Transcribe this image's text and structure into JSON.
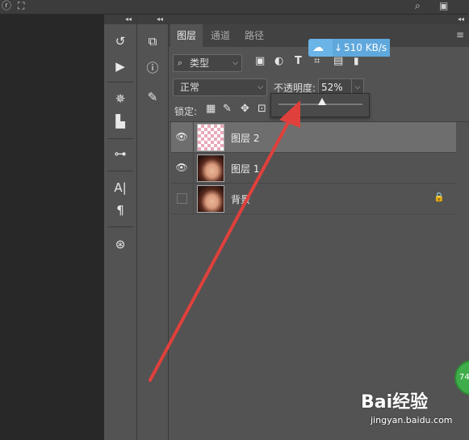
{
  "topbar": {
    "search_icon": "search-icon",
    "window_icon": "window-icon",
    "left_glyph": "ⓡ"
  },
  "column1": {
    "collapse": "◂◂",
    "tools": [
      {
        "name": "history-icon",
        "glyph": "↺"
      },
      {
        "name": "play-icon",
        "glyph": "▶"
      },
      {
        "name": "gear-icon",
        "glyph": "✵"
      },
      {
        "name": "levels-icon",
        "glyph": "▙"
      },
      {
        "name": "adjust-icon",
        "glyph": "⊶"
      },
      {
        "name": "character-icon",
        "glyph": "A|"
      },
      {
        "name": "paragraph-icon",
        "glyph": "¶"
      },
      {
        "name": "share-icon",
        "glyph": "⊛"
      }
    ]
  },
  "column2": {
    "collapse": "◂◂",
    "tools": [
      {
        "name": "cube-icon",
        "glyph": "⧉"
      },
      {
        "name": "info-icon",
        "glyph": "ⓘ"
      },
      {
        "name": "brush-icon",
        "glyph": "✎"
      }
    ]
  },
  "panel": {
    "tabs": [
      {
        "label": "图层",
        "active": true
      },
      {
        "label": "通道"
      },
      {
        "label": "路径"
      }
    ],
    "filter_label": "类型",
    "filter_icons": [
      "image-filter-icon",
      "adjustment-filter-icon",
      "type-filter-icon",
      "shape-filter-icon",
      "smart-filter-icon"
    ],
    "blend_mode": "正常",
    "opacity_label": "不透明度:",
    "opacity_value": "52%",
    "opacity_fraction": 0.52,
    "lock_label": "锁定:",
    "layers": [
      {
        "name": "图层 2",
        "visible": true,
        "selected": true,
        "thumb": "transparent"
      },
      {
        "name": "图层 1",
        "visible": true,
        "selected": false,
        "thumb": "photo"
      },
      {
        "name": "背景",
        "visible": false,
        "selected": false,
        "thumb": "photo",
        "locked": true
      }
    ]
  },
  "download_badge": {
    "speed": "510 KB/s"
  },
  "watermark": {
    "brand": "Bai经验",
    "url": "jingyan.baidu.com"
  },
  "corner_badge": {
    "text": "74"
  },
  "annotation": {
    "color": "#e0403c"
  }
}
